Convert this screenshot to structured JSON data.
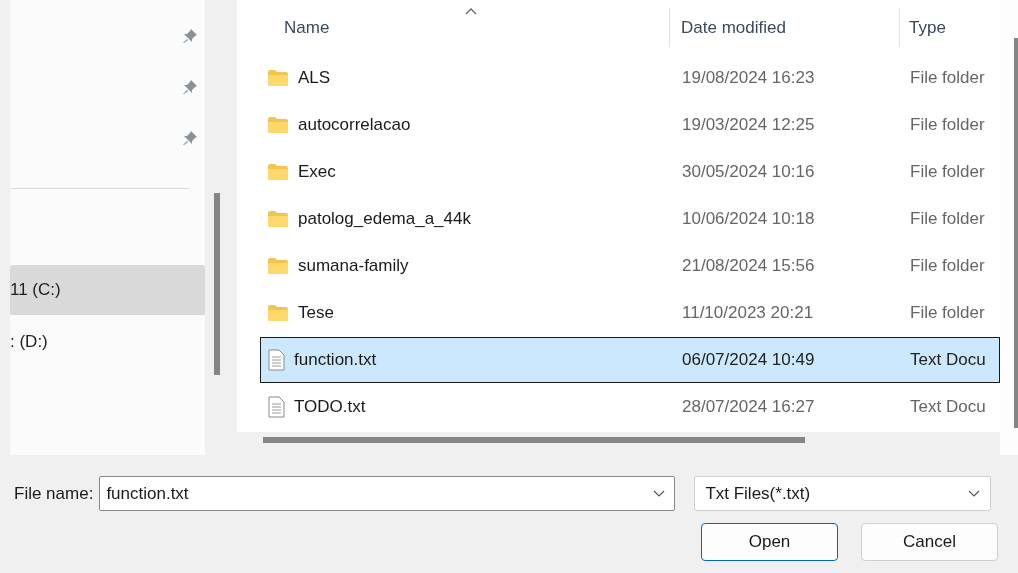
{
  "sidebar": {
    "pinned_items": [
      {
        "pinned": true
      },
      {
        "pinned": true
      },
      {
        "pinned": true
      }
    ],
    "drives": [
      {
        "label": "11 (C:)",
        "selected": true
      },
      {
        "label": ": (D:)",
        "selected": false
      }
    ]
  },
  "file_list": {
    "columns": [
      {
        "label": "Name",
        "sorted": true
      },
      {
        "label": "Date modified",
        "sorted": false
      },
      {
        "label": "Type",
        "sorted": false
      }
    ],
    "rows": [
      {
        "kind": "folder",
        "name": "ALS",
        "date": "19/08/2024 16:23",
        "type": "File folder",
        "selected": false
      },
      {
        "kind": "folder",
        "name": "autocorrelacao",
        "date": "19/03/2024 12:25",
        "type": "File folder",
        "selected": false
      },
      {
        "kind": "folder",
        "name": "Exec",
        "date": "30/05/2024 10:16",
        "type": "File folder",
        "selected": false
      },
      {
        "kind": "folder",
        "name": "patolog_edema_a_44k",
        "date": "10/06/2024 10:18",
        "type": "File folder",
        "selected": false
      },
      {
        "kind": "folder",
        "name": "sumana-family",
        "date": "21/08/2024 15:56",
        "type": "File folder",
        "selected": false
      },
      {
        "kind": "folder",
        "name": "Tese",
        "date": "11/10/2023 20:21",
        "type": "File folder",
        "selected": false
      },
      {
        "kind": "text",
        "name": "function.txt",
        "date": "06/07/2024 10:49",
        "type": "Text Docu",
        "selected": true
      },
      {
        "kind": "text",
        "name": "TODO.txt",
        "date": "28/07/2024 16:27",
        "type": "Text Docu",
        "selected": false
      }
    ]
  },
  "file_name": {
    "label": "File name:",
    "value": "function.txt"
  },
  "file_type": {
    "value": "Txt Files(*.txt)"
  },
  "buttons": [
    {
      "label": "Open",
      "default": true
    },
    {
      "label": "Cancel",
      "default": false
    }
  ]
}
